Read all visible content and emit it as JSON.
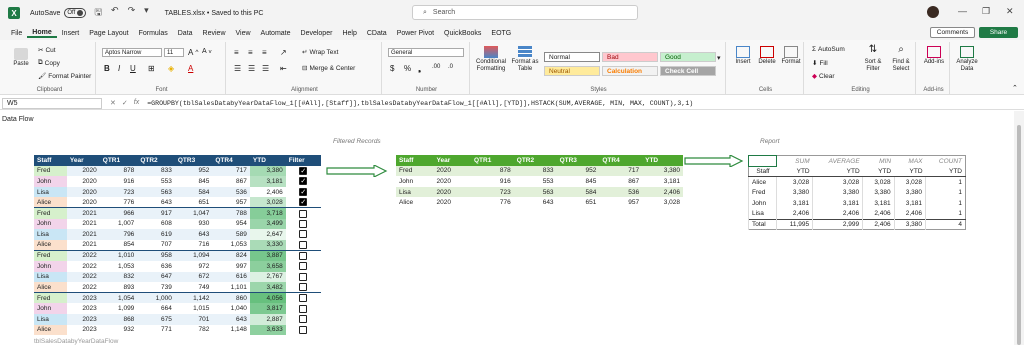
{
  "titlebar": {
    "logo": "X",
    "autosave": "AutoSave",
    "toggle": "Off",
    "filename": "TABLES.xlsx • Saved to this PC",
    "search_placeholder": "Search"
  },
  "menu": [
    "File",
    "Home",
    "Insert",
    "Page Layout",
    "Formulas",
    "Data",
    "Review",
    "View",
    "Automate",
    "Developer",
    "Help",
    "CData",
    "Power Pivot",
    "QuickBooks",
    "EOTG"
  ],
  "buttons": {
    "comments": "Comments",
    "share": "Share"
  },
  "ribbon": {
    "clipboard": {
      "paste": "Paste",
      "cut": "Cut",
      "copy": "Copy",
      "format_painter": "Format Painter",
      "label": "Clipboard"
    },
    "font": {
      "name": "Aptos Narrow",
      "size": "11",
      "label": "Font"
    },
    "alignment": {
      "wrap": "Wrap Text",
      "merge": "Merge & Center",
      "label": "Alignment"
    },
    "number": {
      "format": "General",
      "label": "Number"
    },
    "styles": {
      "cond": "Conditional Formatting",
      "table": "Format as Table",
      "normal": "Normal",
      "bad": "Bad",
      "good": "Good",
      "neutral": "Neutral",
      "calculation": "Calculation",
      "check": "Check Cell",
      "label": "Styles"
    },
    "cells": {
      "insert": "Insert",
      "delete": "Delete",
      "format": "Format",
      "label": "Cells"
    },
    "editing": {
      "autosum": "AutoSum",
      "fill": "Fill",
      "clear": "Clear",
      "sort": "Sort & Filter",
      "find": "Find & Select",
      "label": "Editing"
    },
    "addins": {
      "addins": "Add-ins",
      "analyze": "Analyze Data",
      "label": "Add-ins"
    }
  },
  "formula": {
    "cell": "W5",
    "text": "=GROUPBY(tblSalesDatabyYearDataFlow_1[[#All],[Staff]],tblSalesDatabyYearDataFlow_1[[#All],[YTD]],HSTACK(SUM,AVERAGE, MIN, MAX, COUNT),3,1)"
  },
  "sheet": {
    "title": "Data Flow",
    "filtered_label": "Filtered Records",
    "report_label": "Report",
    "table_name": "tblSalesDatabyYearDataFlow",
    "source": {
      "headers": [
        "Staff",
        "Year",
        "QTR1",
        "QTR2",
        "QTR3",
        "QTR4",
        "YTD",
        "Filter"
      ],
      "rows": [
        [
          "Fred",
          "2020",
          "878",
          "833",
          "952",
          "717",
          "3,380",
          "1"
        ],
        [
          "John",
          "2020",
          "916",
          "553",
          "845",
          "867",
          "3,181",
          "1"
        ],
        [
          "Lisa",
          "2020",
          "723",
          "563",
          "584",
          "536",
          "2,406",
          "1"
        ],
        [
          "Alice",
          "2020",
          "776",
          "643",
          "651",
          "957",
          "3,028",
          "1"
        ],
        [
          "Fred",
          "2021",
          "966",
          "917",
          "1,047",
          "788",
          "3,718",
          "0"
        ],
        [
          "John",
          "2021",
          "1,007",
          "608",
          "930",
          "954",
          "3,499",
          "0"
        ],
        [
          "Lisa",
          "2021",
          "796",
          "619",
          "643",
          "589",
          "2,647",
          "0"
        ],
        [
          "Alice",
          "2021",
          "854",
          "707",
          "716",
          "1,053",
          "3,330",
          "0"
        ],
        [
          "Fred",
          "2022",
          "1,010",
          "958",
          "1,094",
          "824",
          "3,887",
          "0"
        ],
        [
          "John",
          "2022",
          "1,053",
          "636",
          "972",
          "997",
          "3,658",
          "0"
        ],
        [
          "Lisa",
          "2022",
          "832",
          "647",
          "672",
          "616",
          "2,767",
          "0"
        ],
        [
          "Alice",
          "2022",
          "893",
          "739",
          "749",
          "1,101",
          "3,482",
          "0"
        ],
        [
          "Fred",
          "2023",
          "1,054",
          "1,000",
          "1,142",
          "860",
          "4,056",
          "0"
        ],
        [
          "John",
          "2023",
          "1,099",
          "664",
          "1,015",
          "1,040",
          "3,817",
          "0"
        ],
        [
          "Lisa",
          "2023",
          "868",
          "675",
          "701",
          "643",
          "2,887",
          "0"
        ],
        [
          "Alice",
          "2023",
          "932",
          "771",
          "782",
          "1,148",
          "3,633",
          "0"
        ]
      ]
    },
    "filtered": {
      "headers": [
        "Staff",
        "Year",
        "QTR1",
        "QTR2",
        "QTR3",
        "QTR4",
        "YTD"
      ],
      "rows": [
        [
          "Fred",
          "2020",
          "878",
          "833",
          "952",
          "717",
          "3,380"
        ],
        [
          "John",
          "2020",
          "916",
          "553",
          "845",
          "867",
          "3,181"
        ],
        [
          "Lisa",
          "2020",
          "723",
          "563",
          "584",
          "536",
          "2,406"
        ],
        [
          "Alice",
          "2020",
          "776",
          "643",
          "651",
          "957",
          "3,028"
        ]
      ]
    },
    "report": {
      "top": [
        "",
        "SUM",
        "AVERAGE",
        "MIN",
        "MAX",
        "COUNT"
      ],
      "sub": [
        "Staff",
        "YTD",
        "YTD",
        "YTD",
        "YTD",
        "YTD"
      ],
      "rows": [
        [
          "Alice",
          "3,028",
          "3,028",
          "3,028",
          "3,028",
          "1"
        ],
        [
          "Fred",
          "3,380",
          "3,380",
          "3,380",
          "3,380",
          "1"
        ],
        [
          "John",
          "3,181",
          "3,181",
          "3,181",
          "3,181",
          "1"
        ],
        [
          "Lisa",
          "2,406",
          "2,406",
          "2,406",
          "2,406",
          "1"
        ],
        [
          "Total",
          "11,995",
          "2,999",
          "2,406",
          "3,380",
          "4"
        ]
      ]
    }
  },
  "colors": {
    "header_blue": "#1f4e79",
    "header_green": "#4ea72e",
    "excel_green": "#1f7a45"
  }
}
